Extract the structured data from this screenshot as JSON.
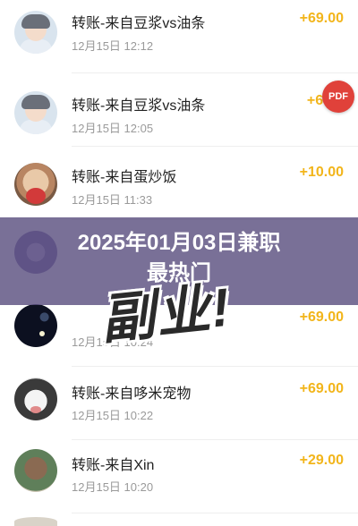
{
  "transactions": [
    {
      "title": "转账-来自豆浆vs油条",
      "date": "12月15日 12:12",
      "amount": "+69.00",
      "avatar": "person-avatar"
    },
    {
      "title": "转账-来自豆浆vs油条",
      "date": "12月15日 12:05",
      "amount": "+69",
      "avatar": "person-avatar"
    },
    {
      "title": "转账-来自蛋炒饭",
      "date": "12月15日 11:33",
      "amount": "+10.00",
      "avatar": "dog-avatar"
    },
    {
      "title": "",
      "date": "",
      "amount": "",
      "avatar": "purple-avatar"
    },
    {
      "title": "",
      "date": "12月15日 10:24",
      "amount": "+69.00",
      "avatar": "night-sky-avatar"
    },
    {
      "title": "转账-来自哆米宠物",
      "date": "12月15日 10:22",
      "amount": "+69.00",
      "avatar": "husky-avatar"
    },
    {
      "title": "转账-来自Xin",
      "date": "12月15日 10:20",
      "amount": "+29.00",
      "avatar": "landscape-avatar"
    }
  ],
  "overlay": {
    "pdf_badge": "PDF",
    "banner_line1": "2025年01月03日兼职",
    "banner_line2": "最热门",
    "big_word": "副业!"
  },
  "colors": {
    "amount": "#f2b51b",
    "banner": "#5c5080",
    "pdf_badge": "#e0413a"
  }
}
